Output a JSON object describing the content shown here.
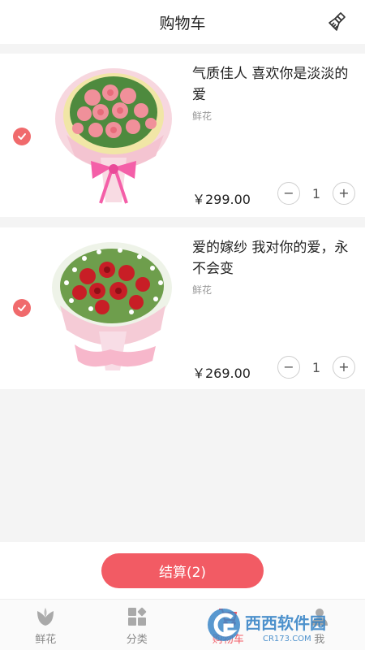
{
  "header": {
    "title": "购物车",
    "clean_icon": "broom-icon"
  },
  "cart": {
    "items": [
      {
        "name": "气质佳人 喜欢你是淡淡的爱",
        "category": "鲜花",
        "price": "￥299.00",
        "quantity": "1",
        "selected": true
      },
      {
        "name": "爱的嫁纱 我对你的爱，永不会变",
        "category": "鲜花",
        "price": "￥269.00",
        "quantity": "1",
        "selected": true
      }
    ],
    "minus_symbol": "−",
    "plus_symbol": "+"
  },
  "checkout": {
    "label": "结算(2)"
  },
  "tabbar": {
    "tabs": [
      {
        "label": "鲜花",
        "icon": "flower-icon",
        "active": false
      },
      {
        "label": "分类",
        "icon": "category-icon",
        "active": false
      },
      {
        "label": "购物车",
        "icon": "cart-icon",
        "active": true
      },
      {
        "label": "我",
        "icon": "user-icon",
        "active": false
      }
    ]
  },
  "watermark": {
    "text": "西西软件园",
    "sub": "CR173.COM"
  },
  "colors": {
    "accent": "#f25b64",
    "check": "#f06a6c",
    "background": "#f4f4f4"
  }
}
